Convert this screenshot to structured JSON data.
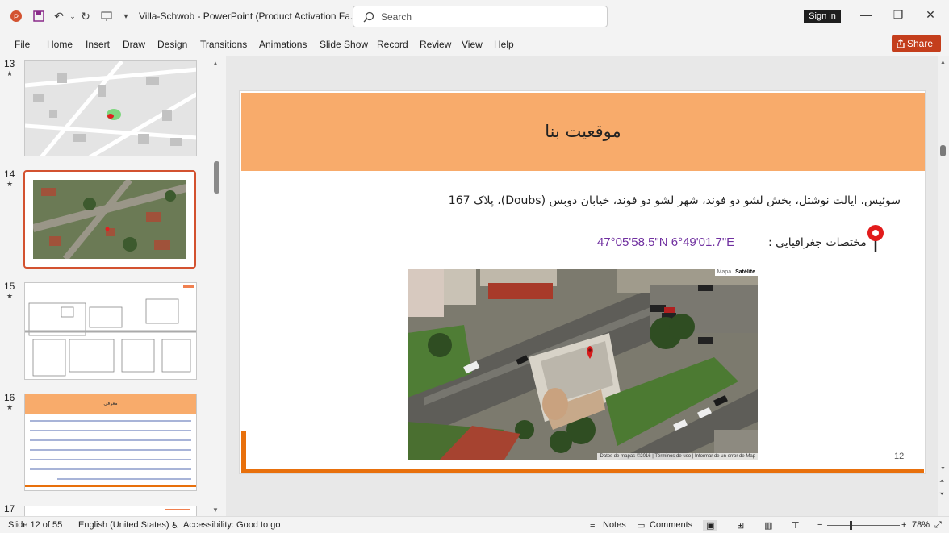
{
  "titlebar": {
    "title": "Villa-Schwob  -  PowerPoint (Product Activation Fa...",
    "search_placeholder": "Search",
    "signin_label": "Sign in"
  },
  "menu": [
    "File",
    "Home",
    "Insert",
    "Draw",
    "Design",
    "Transitions",
    "Animations",
    "Slide Show",
    "Record",
    "Review",
    "View",
    "Help"
  ],
  "share_label": "Share",
  "slides_panel": {
    "items": [
      {
        "num": "13",
        "star": "★"
      },
      {
        "num": "14",
        "star": "★"
      },
      {
        "num": "15",
        "star": "★"
      },
      {
        "num": "16",
        "star": "★"
      },
      {
        "num": "17",
        "star": ""
      }
    ],
    "thumb16_title": "معرفی"
  },
  "slide": {
    "title": "موقعیت بنا",
    "address": "سوئیس، ایالت نوشتل، بخش لشو دو فوند، شهر لشو دو فوند، خیابان دوبس (Doubs)، پلاک 167",
    "coord_label": ": مختصات جغرافیایی",
    "coord_value": "47°05'58.5\"N 6°49'01.7\"E",
    "map_tab_1": "Mapa",
    "map_tab_2": "Satélite",
    "map_footer": "Datos de mapas ©2016  |  Términos de uso  |  Informar de un error de Map",
    "number": "12"
  },
  "status": {
    "slide_info": "Slide 12 of 55",
    "language": "English (United States)",
    "accessibility": "Accessibility: Good to go",
    "notes": "Notes",
    "comments": "Comments",
    "zoom": "78%"
  },
  "colors": {
    "accent": "#c43e1c",
    "header": "#f8ab6b",
    "orange_line": "#e8700c",
    "coord": "#7030a0"
  }
}
